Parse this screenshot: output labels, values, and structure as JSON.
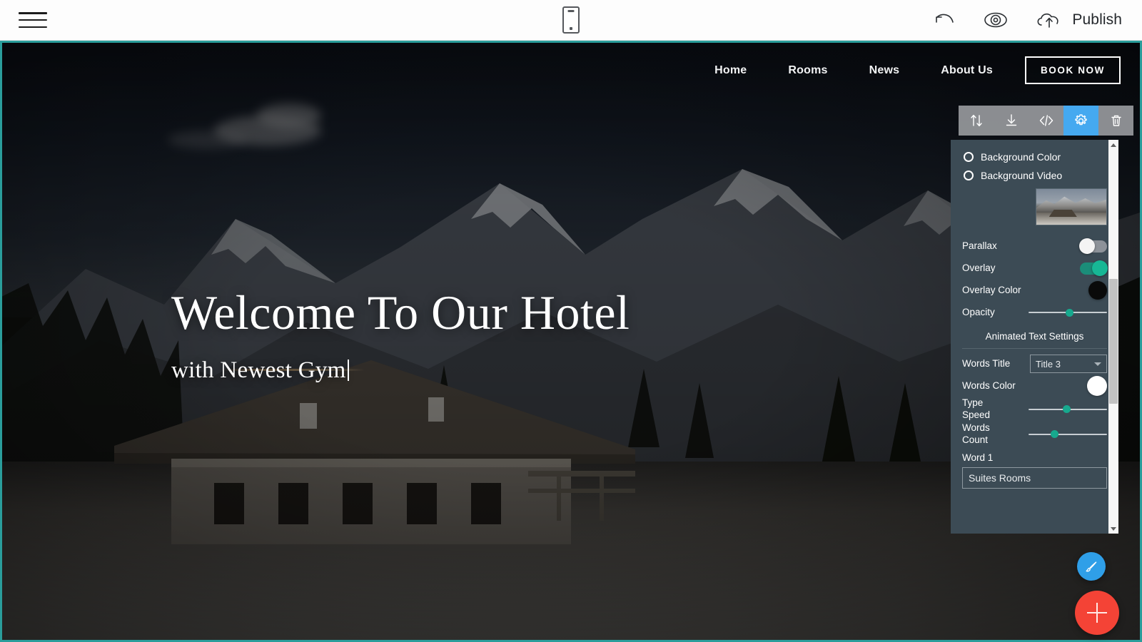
{
  "appbar": {
    "menu_icon": "hamburger-menu-icon",
    "device_icon": "mobile-phone-icon",
    "undo_icon": "undo-icon",
    "preview_icon": "eye-preview-icon",
    "publish_icon": "cloud-upload-icon",
    "publish_label": "Publish"
  },
  "site_nav": {
    "items": [
      {
        "label": "Home"
      },
      {
        "label": "Rooms"
      },
      {
        "label": "News"
      },
      {
        "label": "About Us"
      }
    ],
    "cta_label": "BOOK NOW"
  },
  "hero": {
    "title": "Welcome To Our Hotel",
    "subtitle": "with Newest Gym"
  },
  "block_toolbar": {
    "buttons": [
      {
        "name": "move-block-icon",
        "icon": "up-down-arrows",
        "active": false
      },
      {
        "name": "download-block-icon",
        "icon": "download-arrow",
        "active": false
      },
      {
        "name": "edit-code-icon",
        "icon": "angle-brackets",
        "active": false
      },
      {
        "name": "block-settings-icon",
        "icon": "gear",
        "active": true
      },
      {
        "name": "delete-block-icon",
        "icon": "trash-can",
        "active": false
      }
    ],
    "active_color": "#45a9f0"
  },
  "settings_panel": {
    "radio_options": [
      {
        "label": "Background Color",
        "selected": false
      },
      {
        "label": "Background Video",
        "selected": false
      }
    ],
    "background_image_thumb": "background-image-thumbnail",
    "rows": [
      {
        "label": "Parallax",
        "control": "toggle",
        "value": "off"
      },
      {
        "label": "Overlay",
        "control": "toggle",
        "value": "on"
      },
      {
        "label": "Overlay Color",
        "control": "swatch",
        "value": "#0a0a0a"
      },
      {
        "label": "Opacity",
        "control": "slider",
        "value": 48
      }
    ],
    "section_title": "Animated Text Settings",
    "words_title_label": "Words Title",
    "words_title_value": "Title 3",
    "words_color_label": "Words Color",
    "words_color_value": "#ffffff",
    "type_speed_label": "Type Speed",
    "type_speed_value": 46,
    "words_count_label": "Words Count",
    "words_count_value": 30,
    "word1_label": "Word 1",
    "word1_value": "Suites Rooms",
    "panel_bg": "#3c4b55",
    "accent": "#17a98e"
  },
  "fabs": {
    "style_icon": "paint-brush-icon",
    "add_icon": "plus-icon",
    "style_color": "#2f9fe8",
    "add_color": "#f44336"
  },
  "canvas": {
    "selection_color": "#2a9d9b"
  }
}
